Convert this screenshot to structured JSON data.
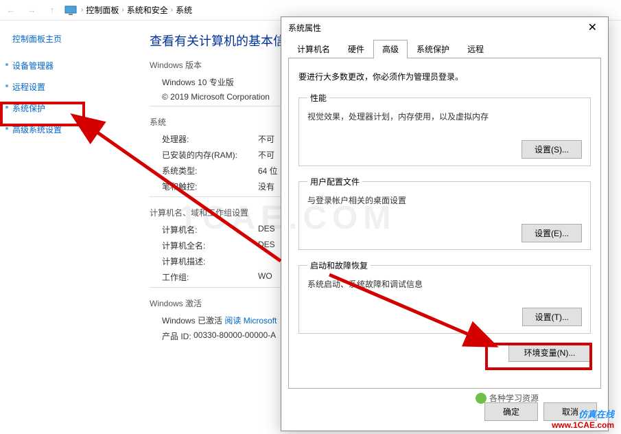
{
  "breadcrumb": {
    "items": [
      "控制面板",
      "系统和安全",
      "系统"
    ],
    "sep": "›"
  },
  "nav": {
    "back": "←",
    "forward": "→",
    "up": "↑"
  },
  "sidebar": {
    "home": "控制面板主页",
    "items": [
      "设备管理器",
      "远程设置",
      "系统保护",
      "高级系统设置"
    ]
  },
  "main": {
    "title": "查看有关计算机的基本信息",
    "sections": {
      "win_version": {
        "title": "Windows 版本",
        "edition": "Windows 10 专业版",
        "copyright": "© 2019 Microsoft Corporation"
      },
      "system": {
        "title": "系统",
        "rows": [
          {
            "label": "处理器:",
            "value": "不可"
          },
          {
            "label": "已安装的内存(RAM):",
            "value": "不可"
          },
          {
            "label": "系统类型:",
            "value": "64 位"
          },
          {
            "label": "笔和触控:",
            "value": "没有"
          }
        ]
      },
      "computer": {
        "title": "计算机名、域和工作组设置",
        "rows": [
          {
            "label": "计算机名:",
            "value": "DES"
          },
          {
            "label": "计算机全名:",
            "value": "DES"
          },
          {
            "label": "计算机描述:",
            "value": ""
          },
          {
            "label": "工作组:",
            "value": "WO"
          }
        ]
      },
      "activation": {
        "title": "Windows 激活",
        "status": "Windows 已激活",
        "link": "阅读 Microsoft",
        "product_id_label": "产品 ID:",
        "product_id": "00330-80000-00000-A"
      }
    }
  },
  "dialog": {
    "title": "系统属性",
    "close": "✕",
    "tabs": [
      "计算机名",
      "硬件",
      "高级",
      "系统保护",
      "远程"
    ],
    "active_tab": 2,
    "note": "要进行大多数更改，你必须作为管理员登录。",
    "groups": {
      "performance": {
        "legend": "性能",
        "desc": "视觉效果，处理器计划，内存使用，以及虚拟内存",
        "button": "设置(S)..."
      },
      "profile": {
        "legend": "用户配置文件",
        "desc": "与登录帐户相关的桌面设置",
        "button": "设置(E)..."
      },
      "startup": {
        "legend": "启动和故障恢复",
        "desc": "系统启动、系统故障和调试信息",
        "button": "设置(T)..."
      }
    },
    "env_button": "环境变量(N)...",
    "footer": {
      "ok": "确定",
      "cancel": "取消"
    }
  },
  "watermark": {
    "bg": "1CAE.COM",
    "label": "各种学习资源",
    "cn": "仿真在线",
    "url": "www.1CAE.com"
  }
}
